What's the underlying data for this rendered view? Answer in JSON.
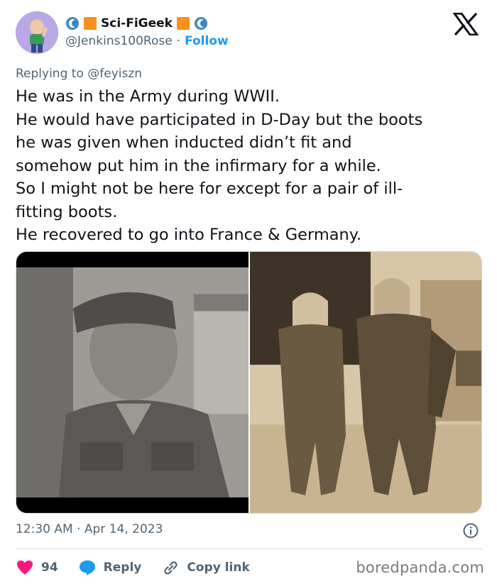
{
  "header": {
    "display_name": "Sci-FiGeek",
    "handle": "@Jenkins100Rose",
    "separator": "·",
    "follow_label": "Follow"
  },
  "replying_to": {
    "prefix": "Replying to ",
    "user": "@feyiszn"
  },
  "tweet": {
    "lines": [
      "He was in the Army during WWII.",
      "He would have participated in D-Day but the boots",
      "he was given when inducted didn’t fit and",
      "somehow put him in the infirmary for a while.",
      "So I might not be here for except for a pair of ill-",
      "fitting boots.",
      "He recovered to go into France & Germany."
    ]
  },
  "meta": {
    "time": "12:30 AM",
    "separator": "·",
    "date": "Apr 14, 2023"
  },
  "actions": {
    "likes": "94",
    "reply_label": "Reply",
    "copy_link_label": "Copy link"
  },
  "watermark": "boredpanda.com",
  "colors": {
    "accent": "#1d9bf0",
    "like": "#f91880",
    "text": "#0f1419",
    "muted": "#536471",
    "emoji_square": "#f7911e"
  },
  "icons": [
    "wave-icon",
    "orange-square-icon",
    "x-logo-icon",
    "info-icon",
    "heart-icon",
    "reply-bubble-icon",
    "link-icon"
  ]
}
